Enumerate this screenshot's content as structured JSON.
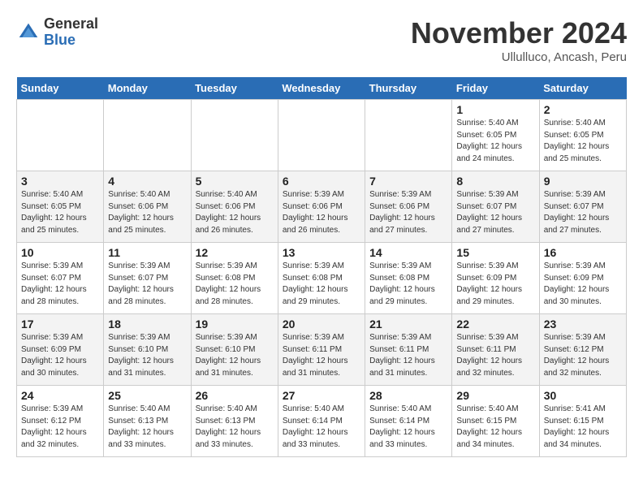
{
  "header": {
    "logo_general": "General",
    "logo_blue": "Blue",
    "month_title": "November 2024",
    "location": "Ullulluco, Ancash, Peru"
  },
  "days_of_week": [
    "Sunday",
    "Monday",
    "Tuesday",
    "Wednesday",
    "Thursday",
    "Friday",
    "Saturday"
  ],
  "weeks": [
    [
      {
        "day": "",
        "empty": true
      },
      {
        "day": "",
        "empty": true
      },
      {
        "day": "",
        "empty": true
      },
      {
        "day": "",
        "empty": true
      },
      {
        "day": "",
        "empty": true
      },
      {
        "day": "1",
        "sunrise": "Sunrise: 5:40 AM",
        "sunset": "Sunset: 6:05 PM",
        "daylight": "Daylight: 12 hours and 24 minutes."
      },
      {
        "day": "2",
        "sunrise": "Sunrise: 5:40 AM",
        "sunset": "Sunset: 6:05 PM",
        "daylight": "Daylight: 12 hours and 25 minutes."
      }
    ],
    [
      {
        "day": "3",
        "sunrise": "Sunrise: 5:40 AM",
        "sunset": "Sunset: 6:05 PM",
        "daylight": "Daylight: 12 hours and 25 minutes."
      },
      {
        "day": "4",
        "sunrise": "Sunrise: 5:40 AM",
        "sunset": "Sunset: 6:06 PM",
        "daylight": "Daylight: 12 hours and 25 minutes."
      },
      {
        "day": "5",
        "sunrise": "Sunrise: 5:40 AM",
        "sunset": "Sunset: 6:06 PM",
        "daylight": "Daylight: 12 hours and 26 minutes."
      },
      {
        "day": "6",
        "sunrise": "Sunrise: 5:39 AM",
        "sunset": "Sunset: 6:06 PM",
        "daylight": "Daylight: 12 hours and 26 minutes."
      },
      {
        "day": "7",
        "sunrise": "Sunrise: 5:39 AM",
        "sunset": "Sunset: 6:06 PM",
        "daylight": "Daylight: 12 hours and 27 minutes."
      },
      {
        "day": "8",
        "sunrise": "Sunrise: 5:39 AM",
        "sunset": "Sunset: 6:07 PM",
        "daylight": "Daylight: 12 hours and 27 minutes."
      },
      {
        "day": "9",
        "sunrise": "Sunrise: 5:39 AM",
        "sunset": "Sunset: 6:07 PM",
        "daylight": "Daylight: 12 hours and 27 minutes."
      }
    ],
    [
      {
        "day": "10",
        "sunrise": "Sunrise: 5:39 AM",
        "sunset": "Sunset: 6:07 PM",
        "daylight": "Daylight: 12 hours and 28 minutes."
      },
      {
        "day": "11",
        "sunrise": "Sunrise: 5:39 AM",
        "sunset": "Sunset: 6:07 PM",
        "daylight": "Daylight: 12 hours and 28 minutes."
      },
      {
        "day": "12",
        "sunrise": "Sunrise: 5:39 AM",
        "sunset": "Sunset: 6:08 PM",
        "daylight": "Daylight: 12 hours and 28 minutes."
      },
      {
        "day": "13",
        "sunrise": "Sunrise: 5:39 AM",
        "sunset": "Sunset: 6:08 PM",
        "daylight": "Daylight: 12 hours and 29 minutes."
      },
      {
        "day": "14",
        "sunrise": "Sunrise: 5:39 AM",
        "sunset": "Sunset: 6:08 PM",
        "daylight": "Daylight: 12 hours and 29 minutes."
      },
      {
        "day": "15",
        "sunrise": "Sunrise: 5:39 AM",
        "sunset": "Sunset: 6:09 PM",
        "daylight": "Daylight: 12 hours and 29 minutes."
      },
      {
        "day": "16",
        "sunrise": "Sunrise: 5:39 AM",
        "sunset": "Sunset: 6:09 PM",
        "daylight": "Daylight: 12 hours and 30 minutes."
      }
    ],
    [
      {
        "day": "17",
        "sunrise": "Sunrise: 5:39 AM",
        "sunset": "Sunset: 6:09 PM",
        "daylight": "Daylight: 12 hours and 30 minutes."
      },
      {
        "day": "18",
        "sunrise": "Sunrise: 5:39 AM",
        "sunset": "Sunset: 6:10 PM",
        "daylight": "Daylight: 12 hours and 31 minutes."
      },
      {
        "day": "19",
        "sunrise": "Sunrise: 5:39 AM",
        "sunset": "Sunset: 6:10 PM",
        "daylight": "Daylight: 12 hours and 31 minutes."
      },
      {
        "day": "20",
        "sunrise": "Sunrise: 5:39 AM",
        "sunset": "Sunset: 6:11 PM",
        "daylight": "Daylight: 12 hours and 31 minutes."
      },
      {
        "day": "21",
        "sunrise": "Sunrise: 5:39 AM",
        "sunset": "Sunset: 6:11 PM",
        "daylight": "Daylight: 12 hours and 31 minutes."
      },
      {
        "day": "22",
        "sunrise": "Sunrise: 5:39 AM",
        "sunset": "Sunset: 6:11 PM",
        "daylight": "Daylight: 12 hours and 32 minutes."
      },
      {
        "day": "23",
        "sunrise": "Sunrise: 5:39 AM",
        "sunset": "Sunset: 6:12 PM",
        "daylight": "Daylight: 12 hours and 32 minutes."
      }
    ],
    [
      {
        "day": "24",
        "sunrise": "Sunrise: 5:39 AM",
        "sunset": "Sunset: 6:12 PM",
        "daylight": "Daylight: 12 hours and 32 minutes."
      },
      {
        "day": "25",
        "sunrise": "Sunrise: 5:40 AM",
        "sunset": "Sunset: 6:13 PM",
        "daylight": "Daylight: 12 hours and 33 minutes."
      },
      {
        "day": "26",
        "sunrise": "Sunrise: 5:40 AM",
        "sunset": "Sunset: 6:13 PM",
        "daylight": "Daylight: 12 hours and 33 minutes."
      },
      {
        "day": "27",
        "sunrise": "Sunrise: 5:40 AM",
        "sunset": "Sunset: 6:14 PM",
        "daylight": "Daylight: 12 hours and 33 minutes."
      },
      {
        "day": "28",
        "sunrise": "Sunrise: 5:40 AM",
        "sunset": "Sunset: 6:14 PM",
        "daylight": "Daylight: 12 hours and 33 minutes."
      },
      {
        "day": "29",
        "sunrise": "Sunrise: 5:40 AM",
        "sunset": "Sunset: 6:15 PM",
        "daylight": "Daylight: 12 hours and 34 minutes."
      },
      {
        "day": "30",
        "sunrise": "Sunrise: 5:41 AM",
        "sunset": "Sunset: 6:15 PM",
        "daylight": "Daylight: 12 hours and 34 minutes."
      }
    ]
  ]
}
